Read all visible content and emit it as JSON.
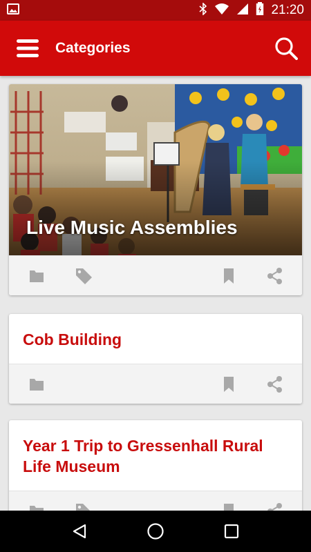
{
  "status_bar": {
    "time": "21:20",
    "icons": [
      "image-icon",
      "bluetooth-icon",
      "wifi-icon",
      "signal-icon",
      "battery-icon"
    ]
  },
  "app_bar": {
    "title": "Categories",
    "menu_icon": "hamburger-menu-icon",
    "search_icon": "search-icon"
  },
  "cards": [
    {
      "title": "Live Music Assemblies",
      "has_image": true,
      "actions": [
        "folder-icon",
        "tag-icon",
        "bookmark-icon",
        "share-icon"
      ]
    },
    {
      "title": "Cob Building",
      "has_image": false,
      "actions": [
        "folder-icon",
        "bookmark-icon",
        "share-icon"
      ]
    },
    {
      "title": "Year 1 Trip to Gressenhall Rural Life Museum",
      "has_image": false,
      "actions": [
        "folder-icon",
        "tag-icon",
        "bookmark-icon",
        "share-icon"
      ]
    }
  ],
  "nav_bar": {
    "buttons": [
      "back-icon",
      "home-icon",
      "recents-icon"
    ]
  },
  "colors": {
    "status_bar": "#a50c0c",
    "app_bar": "#d10a0a",
    "accent_text": "#c80d0d",
    "icon_gray": "#a8a8a8"
  }
}
